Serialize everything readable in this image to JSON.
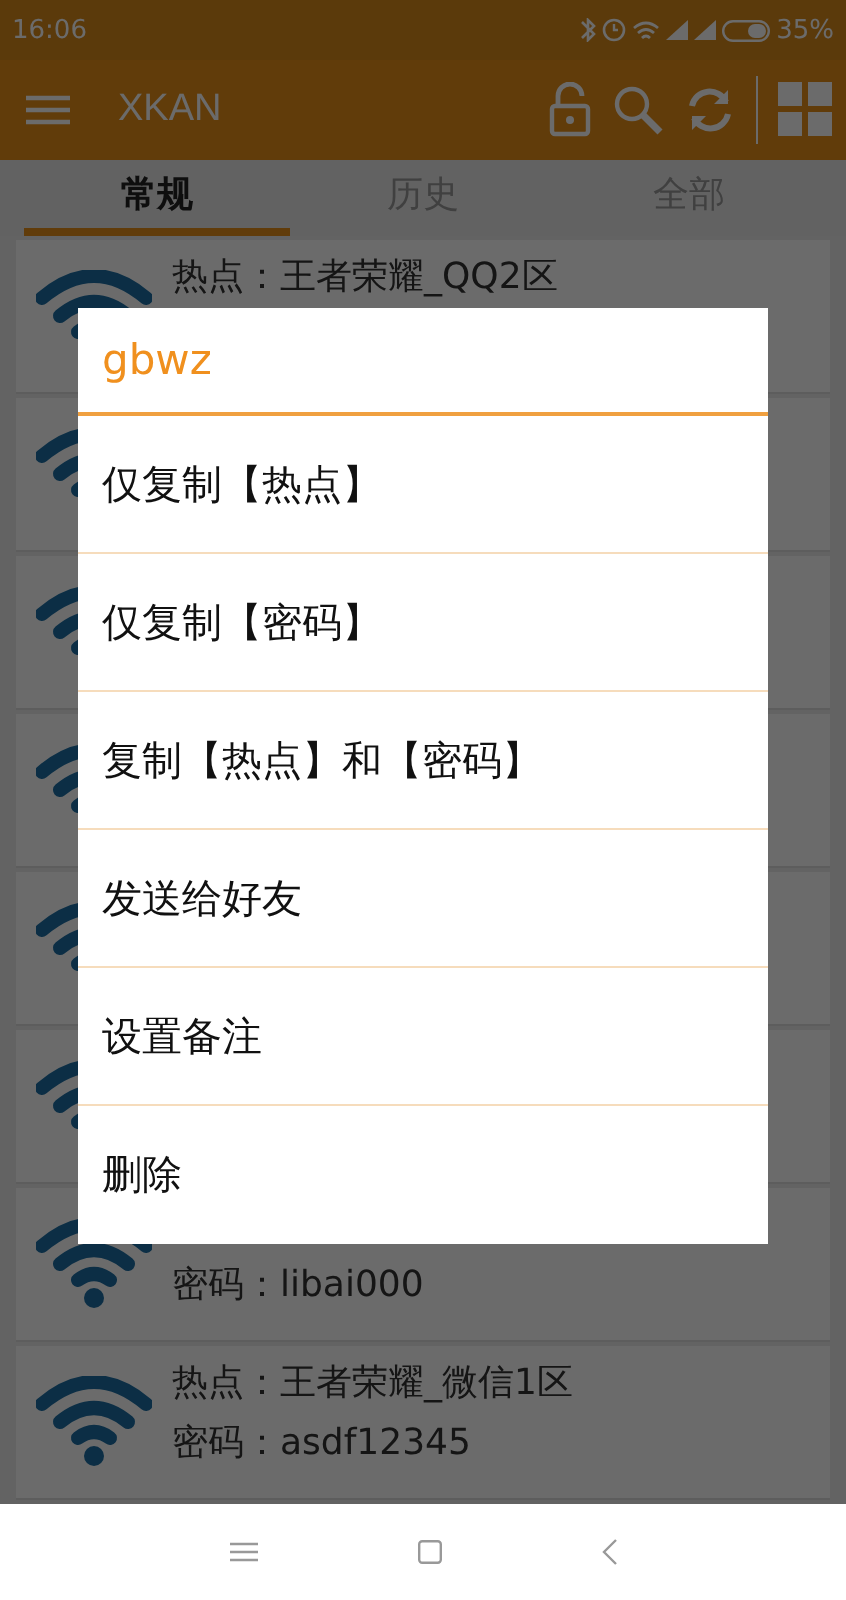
{
  "status_bar": {
    "time": "16:06",
    "battery": "35%"
  },
  "app_bar": {
    "title": "XKAN"
  },
  "tabs": [
    {
      "label": "常规",
      "selected": true
    },
    {
      "label": "历史",
      "selected": false
    },
    {
      "label": "全部",
      "selected": false
    }
  ],
  "hotspots": [
    {
      "kind": "text",
      "hotspot": "热点：王者荣耀_QQ2区"
    },
    {
      "kind": "covered"
    },
    {
      "kind": "covered"
    },
    {
      "kind": "covered"
    },
    {
      "kind": "covered"
    },
    {
      "kind": "covered"
    },
    {
      "kind": "text",
      "password": "密码：libai000"
    },
    {
      "kind": "text",
      "hotspot": "热点：王者荣耀_微信1区",
      "password": "密码：asdf12345"
    }
  ],
  "dialog": {
    "title": "gbwz",
    "items": [
      "仅复制【热点】",
      "仅复制【密码】",
      "复制【热点】和【密码】",
      "发送给好友",
      "设置备注",
      "删除"
    ]
  }
}
